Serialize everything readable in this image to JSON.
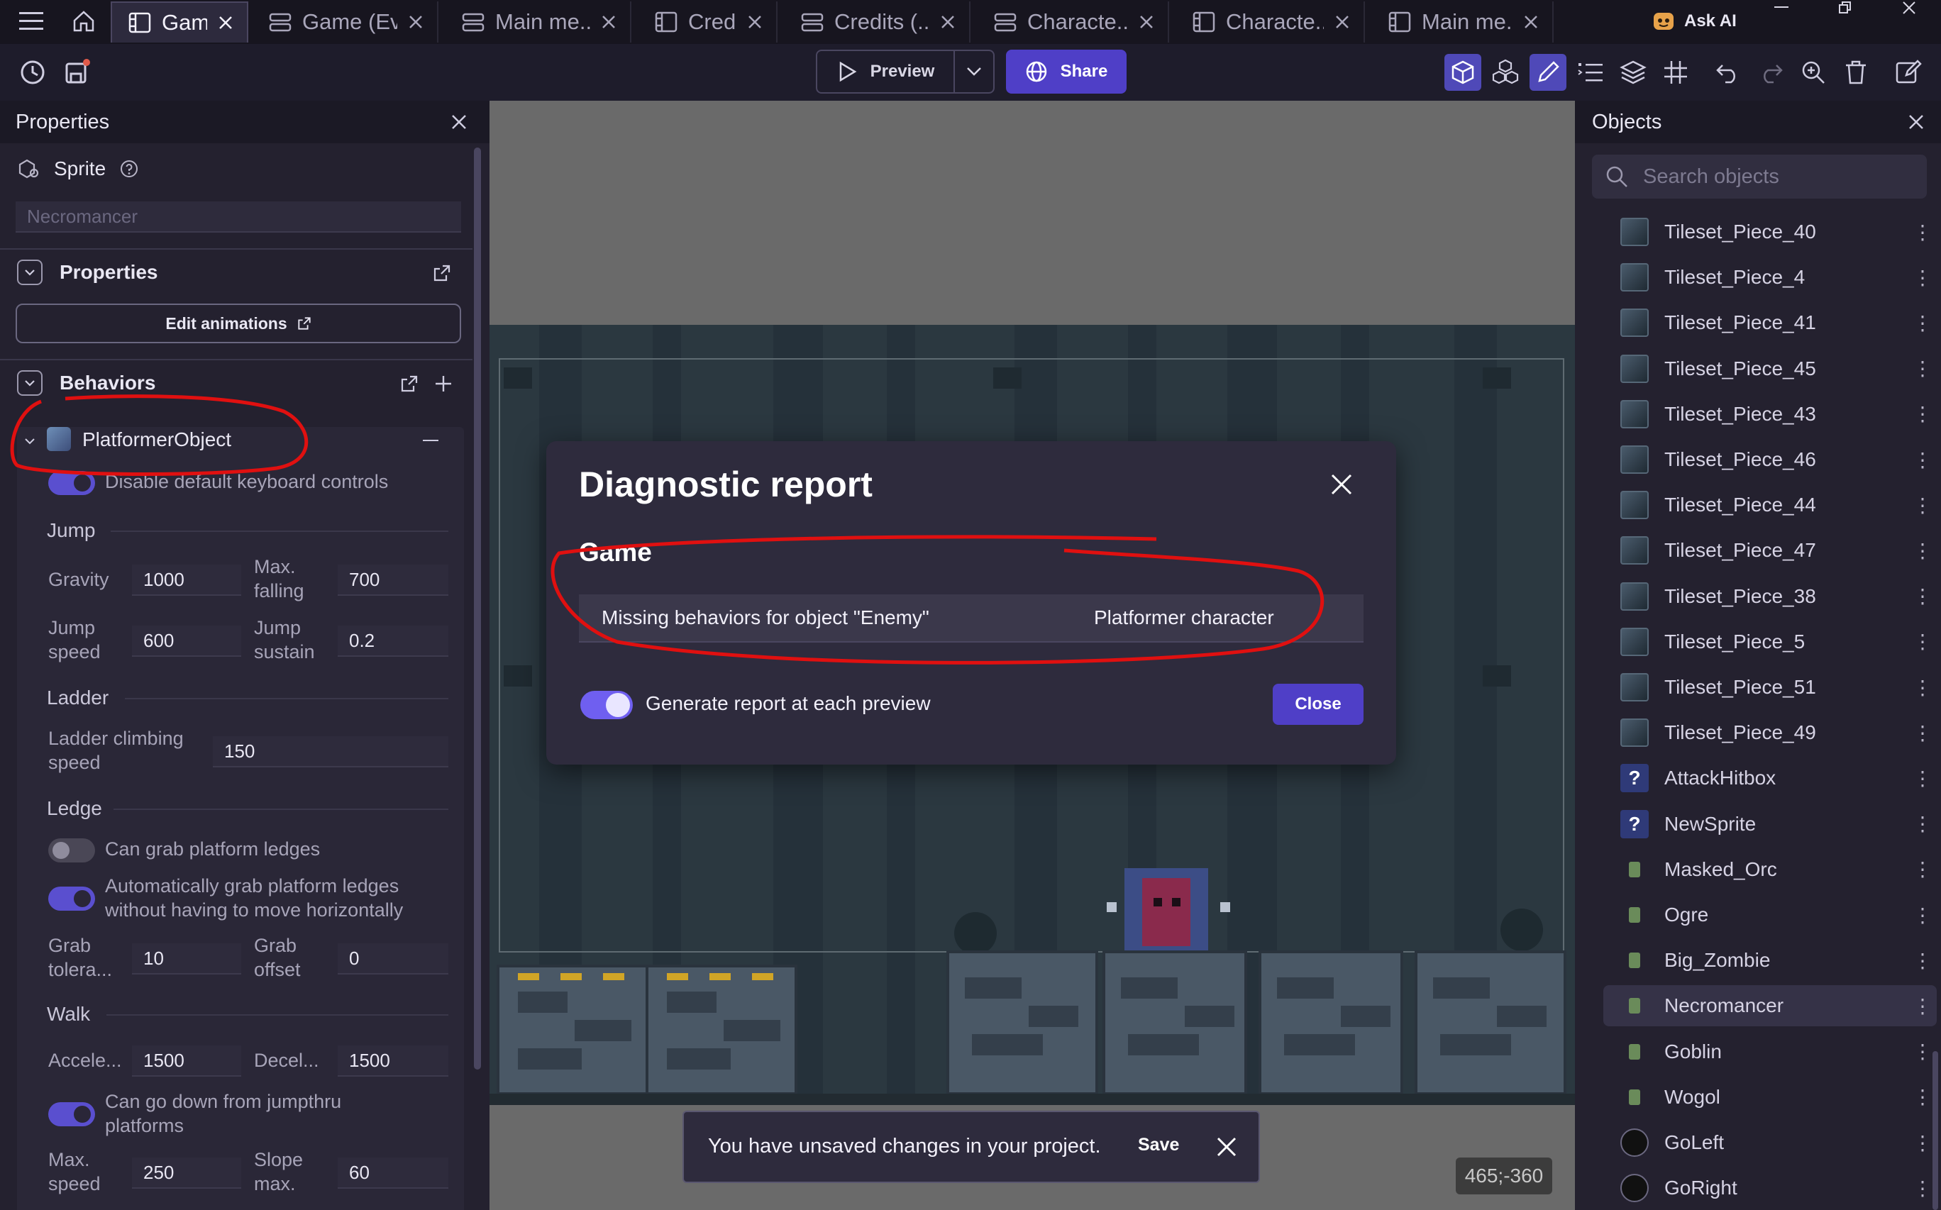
{
  "tabs": [
    {
      "label": "Game",
      "icon": "scene-icon",
      "active": true
    },
    {
      "label": "Game (Ev...",
      "icon": "events-icon"
    },
    {
      "label": "Main me...",
      "icon": "events-icon"
    },
    {
      "label": "Credits",
      "icon": "scene-icon"
    },
    {
      "label": "Credits (...",
      "icon": "events-icon"
    },
    {
      "label": "Characte...",
      "icon": "events-icon"
    },
    {
      "label": "Characte...",
      "icon": "scene-icon"
    },
    {
      "label": "Main me...",
      "icon": "scene-icon"
    }
  ],
  "header": {
    "ask_ai": "Ask AI"
  },
  "toolbar": {
    "preview_label": "Preview",
    "share_label": "Share"
  },
  "properties_panel": {
    "title": "Properties",
    "object_type": "Sprite",
    "object_name_placeholder": "Necromancer",
    "properties_section": "Properties",
    "edit_animations": "Edit animations",
    "behaviors_section": "Behaviors",
    "behavior_name": "PlatformerObject",
    "disable_keyboard": "Disable default keyboard controls",
    "jump": {
      "heading": "Jump",
      "gravity_label": "Gravity",
      "gravity": "1000",
      "max_falling_label_1": "Max.",
      "max_falling_label_2": "falling",
      "max_falling": "700",
      "jump_speed_label_1": "Jump",
      "jump_speed_label_2": "speed",
      "jump_speed": "600",
      "jump_sustain_label_1": "Jump",
      "jump_sustain_label_2": "sustain",
      "jump_sustain": "0.2"
    },
    "ladder": {
      "heading": "Ladder",
      "climb_label_1": "Ladder climbing",
      "climb_label_2": "speed",
      "climb": "150"
    },
    "ledge": {
      "heading": "Ledge",
      "grab_ledges": "Can grab platform ledges",
      "auto_grab_1": "Automatically grab platform ledges",
      "auto_grab_2": "without having to move horizontally",
      "grab_tol_label_1": "Grab",
      "grab_tol_label_2": "tolera...",
      "grab_tol": "10",
      "grab_offset_label_1": "Grab",
      "grab_offset_label_2": "offset",
      "grab_offset": "0"
    },
    "walk": {
      "heading": "Walk",
      "accel_label": "Accele...",
      "accel": "1500",
      "decel_label": "Decel...",
      "decel": "1500",
      "jumpthru_1": "Can go down from jumpthru",
      "jumpthru_2": "platforms",
      "max_speed_label_1": "Max.",
      "max_speed_label_2": "speed",
      "max_speed": "250",
      "slope_label_1": "Slope",
      "slope_label_2": "max.",
      "slope": "60"
    }
  },
  "canvas": {
    "coords": "465;-360"
  },
  "objects_panel": {
    "title": "Objects",
    "search_placeholder": "Search objects",
    "items": [
      {
        "name": "Tileset_Piece_40",
        "icon": "tile-icon"
      },
      {
        "name": "Tileset_Piece_4",
        "icon": "tile-icon"
      },
      {
        "name": "Tileset_Piece_41",
        "icon": "tile-icon"
      },
      {
        "name": "Tileset_Piece_45",
        "icon": "tile-icon"
      },
      {
        "name": "Tileset_Piece_43",
        "icon": "tile-icon"
      },
      {
        "name": "Tileset_Piece_46",
        "icon": "tile-icon"
      },
      {
        "name": "Tileset_Piece_44",
        "icon": "tile-icon"
      },
      {
        "name": "Tileset_Piece_47",
        "icon": "tile-icon"
      },
      {
        "name": "Tileset_Piece_38",
        "icon": "tile-icon"
      },
      {
        "name": "Tileset_Piece_5",
        "icon": "tile-icon"
      },
      {
        "name": "Tileset_Piece_51",
        "icon": "tile-icon"
      },
      {
        "name": "Tileset_Piece_49",
        "icon": "tile-icon"
      },
      {
        "name": "AttackHitbox",
        "icon": "question-icon"
      },
      {
        "name": "NewSprite",
        "icon": "question-icon"
      },
      {
        "name": "Masked_Orc",
        "icon": "character-icon"
      },
      {
        "name": "Ogre",
        "icon": "character-icon"
      },
      {
        "name": "Big_Zombie",
        "icon": "character-icon"
      },
      {
        "name": "Necromancer",
        "icon": "character-icon",
        "selected": true
      },
      {
        "name": "Goblin",
        "icon": "character-icon"
      },
      {
        "name": "Wogol",
        "icon": "character-icon"
      },
      {
        "name": "GoLeft",
        "icon": "circle-icon"
      },
      {
        "name": "GoRight",
        "icon": "circle-icon"
      }
    ]
  },
  "dialog": {
    "title": "Diagnostic report",
    "section": "Game",
    "row_message": "Missing behaviors for object \"Enemy\"",
    "row_behavior": "Platformer character",
    "toggle_label": "Generate report at each preview",
    "close_label": "Close"
  },
  "snackbar": {
    "message": "You have unsaved changes in your project.",
    "save_label": "Save"
  },
  "colors": {
    "accent": "#4f3fc7",
    "annotation": "#e01010",
    "panel": "#24212f"
  }
}
